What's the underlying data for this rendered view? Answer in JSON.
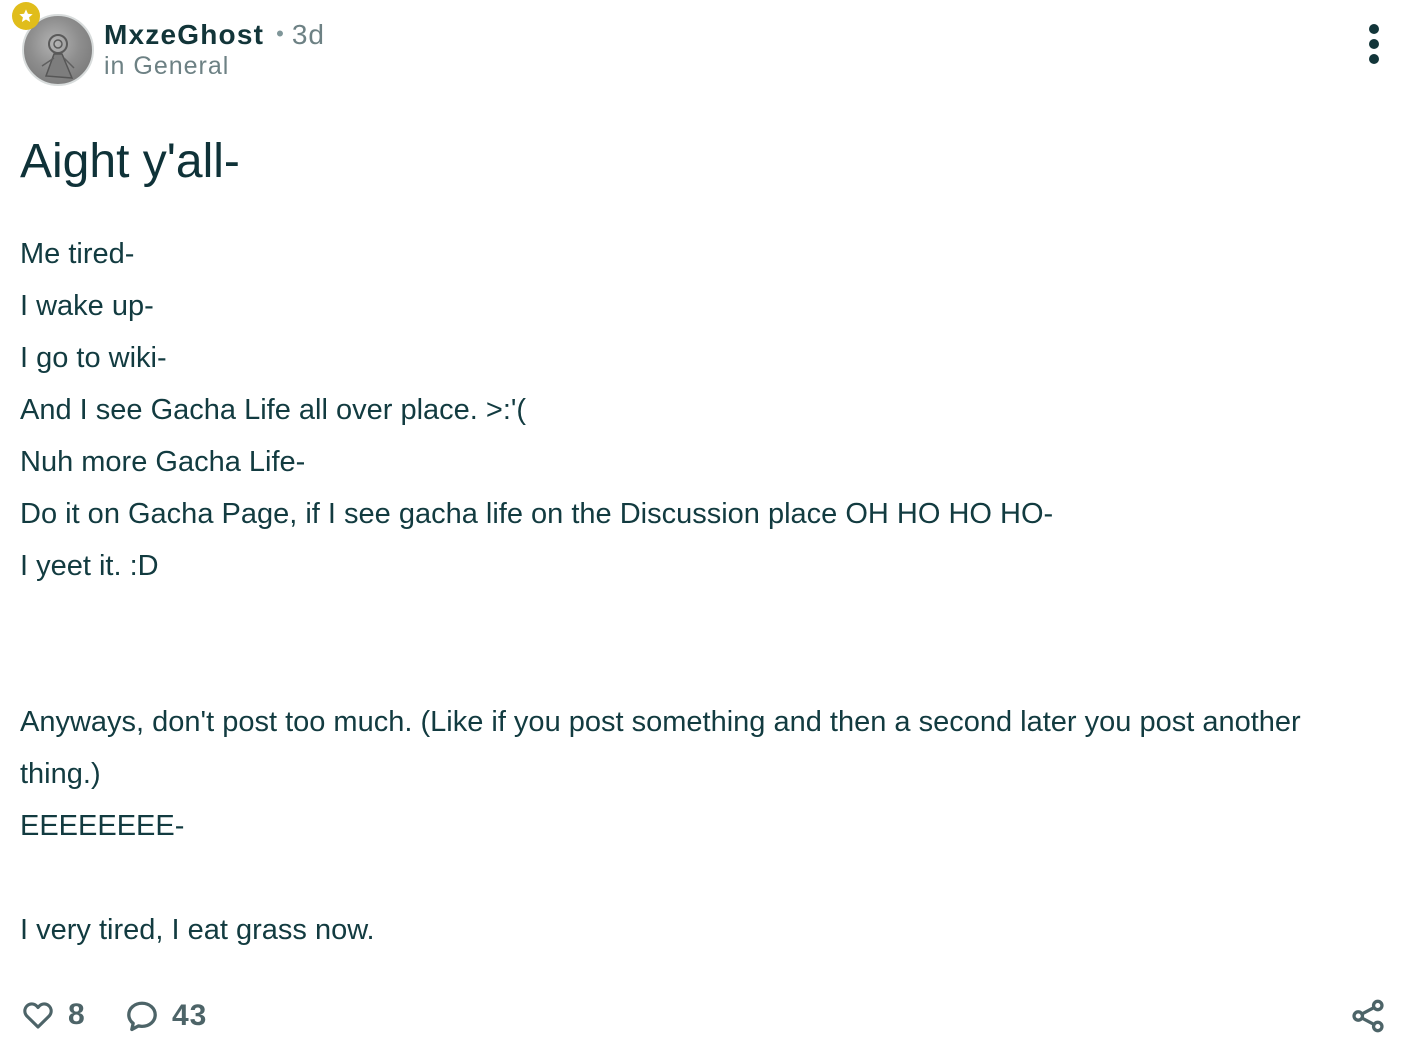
{
  "post": {
    "author": "MxzeGhost",
    "separator": "•",
    "time": "3d",
    "category": "in General",
    "title": "Aight y'all-",
    "body_lines": [
      "Me tired-",
      "I wake up-",
      "I go to wiki-",
      "And I see Gacha Life all over place. >:'(",
      "Nuh more Gacha Life-",
      "Do it on Gacha Page, if I see gacha life on the Discussion place OH HO HO HO-",
      "I yeet it. :D",
      "",
      "",
      "Anyways, don't post too much. (Like if you post something and then a second later you post another thing.)",
      "EEEEEEEE-",
      "",
      "I very tired, I eat grass now."
    ],
    "likes": "8",
    "comments": "43"
  },
  "icons": {
    "badge": "star-badge-icon",
    "more": "more-vertical-icon",
    "like": "heart-icon",
    "comment": "comment-bubble-icon",
    "share": "share-icon"
  },
  "colors": {
    "text": "#0f3238",
    "muted": "#6d8184",
    "badge": "#e0bd1b",
    "icon": "#4d6468"
  }
}
